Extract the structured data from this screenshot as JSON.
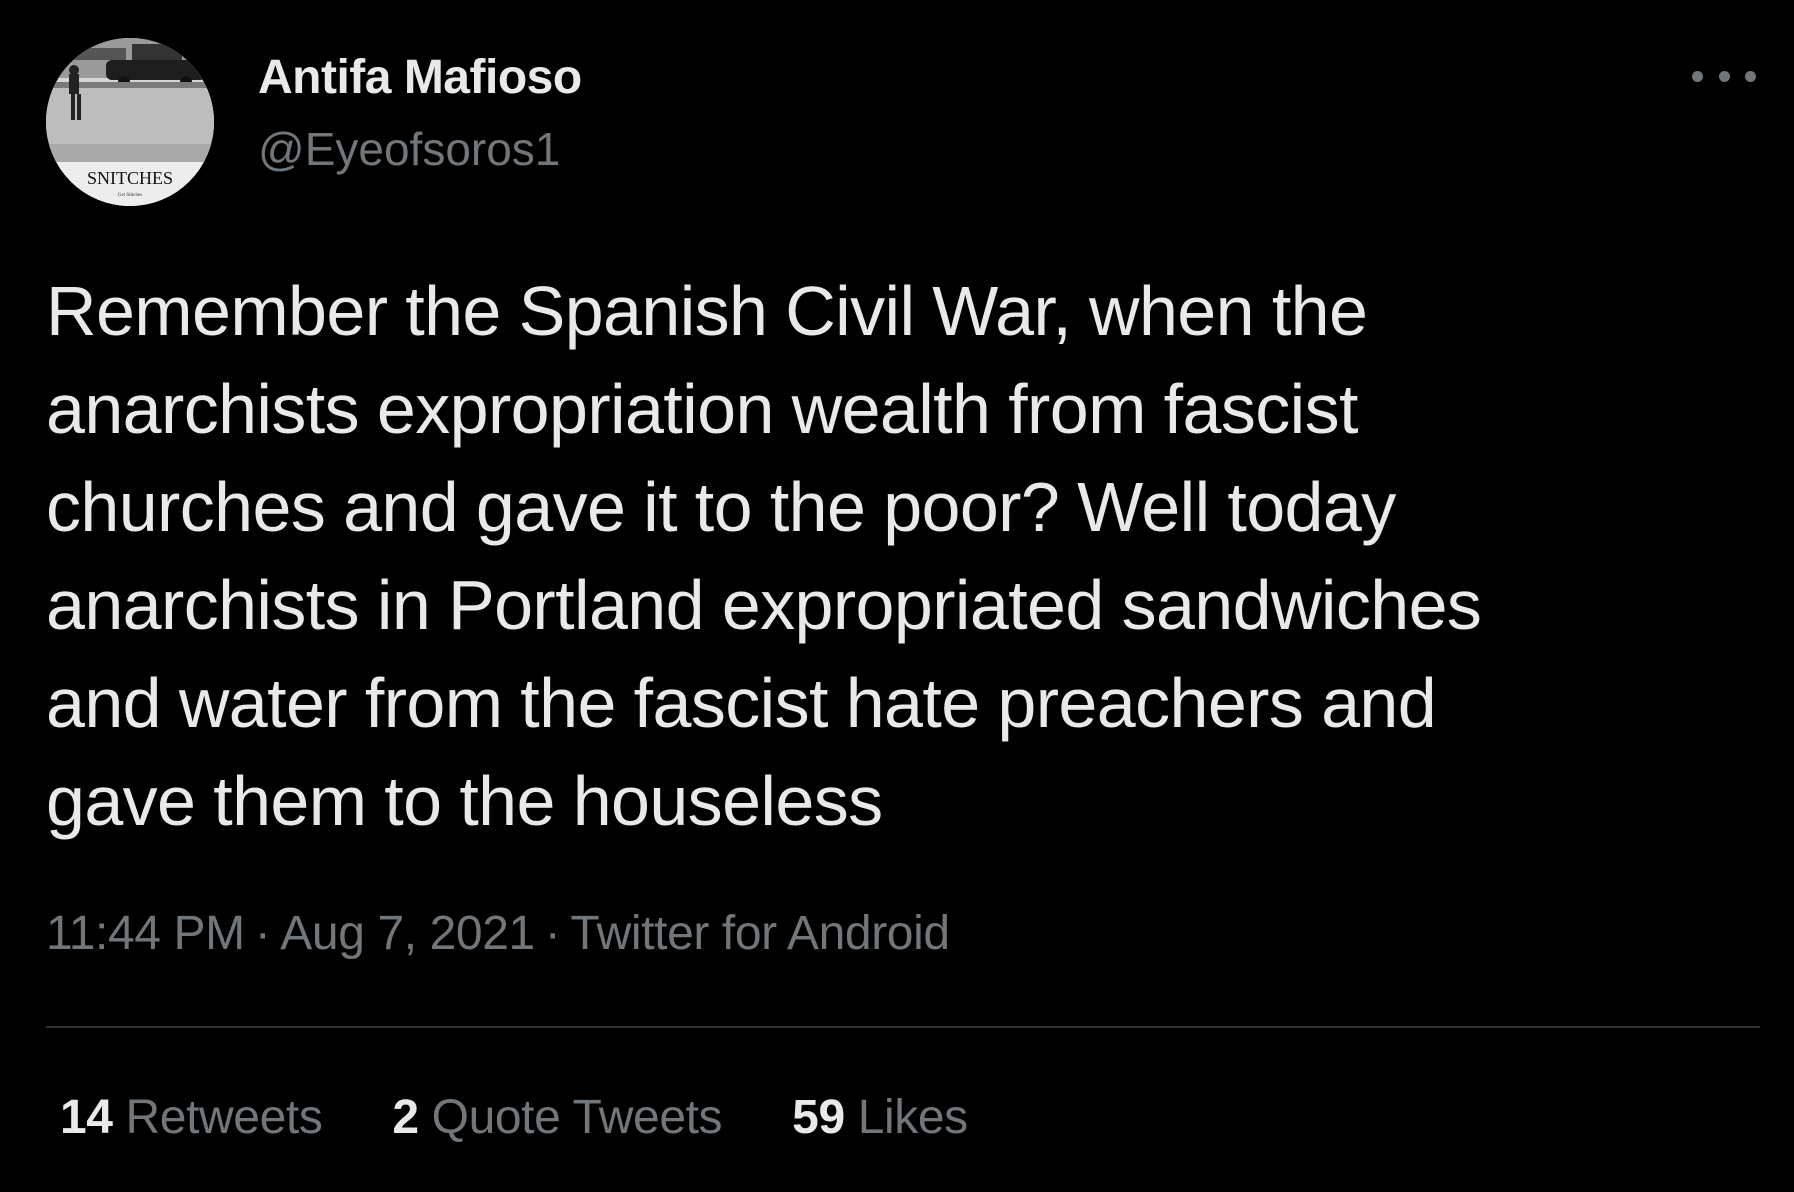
{
  "user": {
    "display_name": "Antifa Mafioso",
    "handle": "@Eyeofsoros1",
    "avatar_caption": "SNITCHES",
    "avatar_subcaption": "Get Stitches"
  },
  "tweet": {
    "text_lines": [
      "Remember the Spanish Civil War, when the",
      "anarchists expropriation wealth from fascist",
      "churches and gave it to the poor? Well today",
      "anarchists in Portland expropriated sandwiches",
      "and water from the fascist hate preachers and",
      "gave them to the houseless"
    ],
    "time": "11:44 PM",
    "date": "Aug 7, 2021",
    "source": "Twitter for Android",
    "separator": "·"
  },
  "stats": {
    "retweets_count": "14",
    "retweets_label": "Retweets",
    "quotes_count": "2",
    "quotes_label": "Quote Tweets",
    "likes_count": "59",
    "likes_label": "Likes"
  },
  "icons": {
    "more": "more-horizontal-icon"
  },
  "colors": {
    "background": "#000000",
    "primary_text": "#e7e9ea",
    "secondary_text": "#71767b",
    "divider": "#2f3336"
  }
}
